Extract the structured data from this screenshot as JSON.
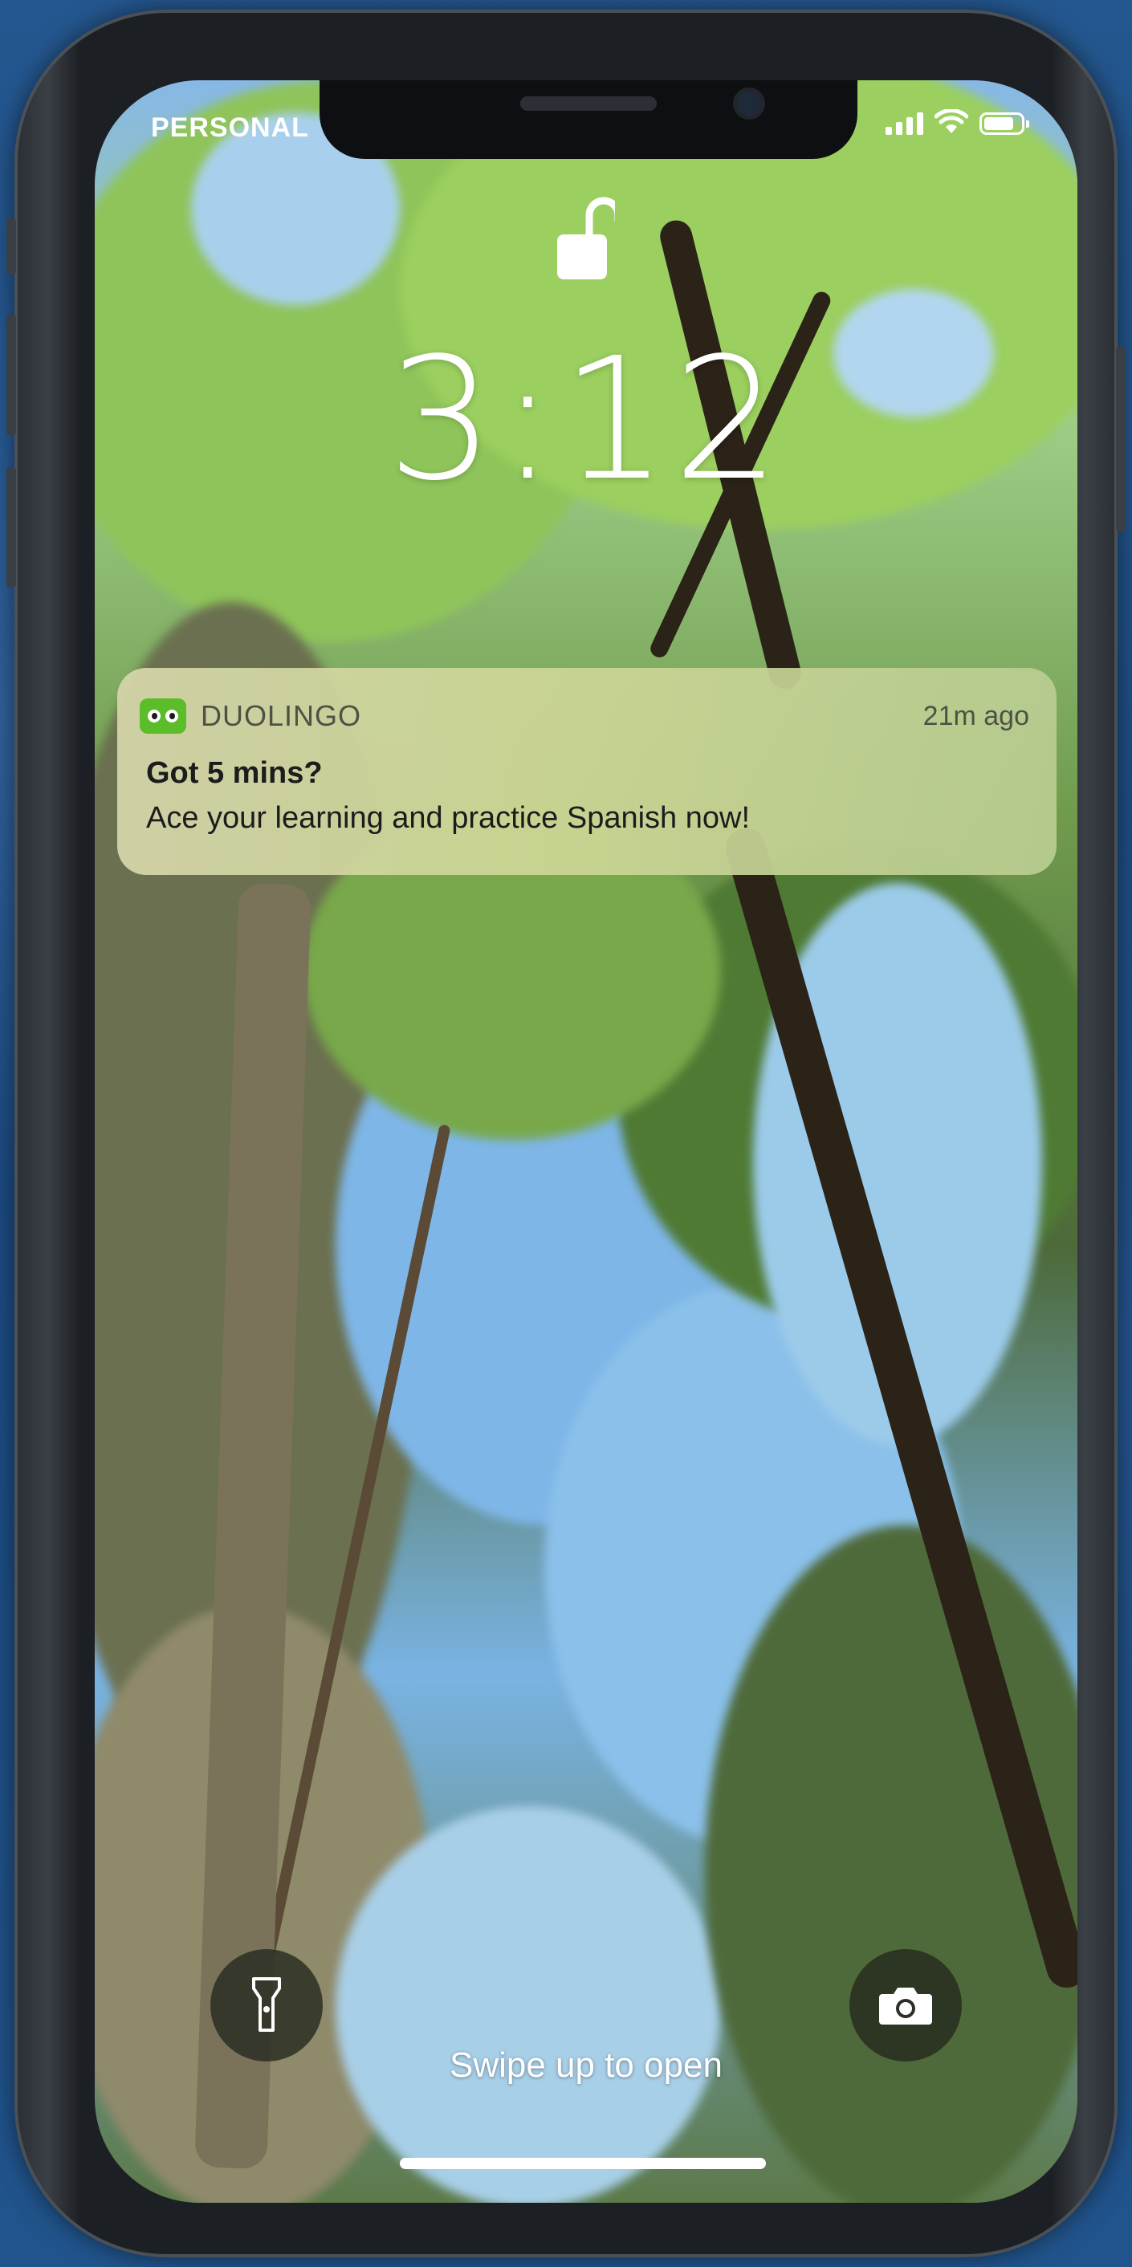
{
  "status_bar": {
    "carrier": "PERSONAL"
  },
  "lock_screen": {
    "time": "3:12",
    "swipe_hint": "Swipe up to open"
  },
  "notification": {
    "app_name": "DUOLINGO",
    "time_ago": "21m ago",
    "title": "Got 5 mins?",
    "body": "Ace your learning and practice Spanish now!",
    "app_icon": "duolingo-owl-icon",
    "app_color": "#5cbd2a"
  },
  "quick_actions": {
    "left_icon": "flashlight-icon",
    "right_icon": "camera-icon"
  },
  "colors": {
    "background": "#1f4f86",
    "phone_frame": "#1c1f23"
  }
}
